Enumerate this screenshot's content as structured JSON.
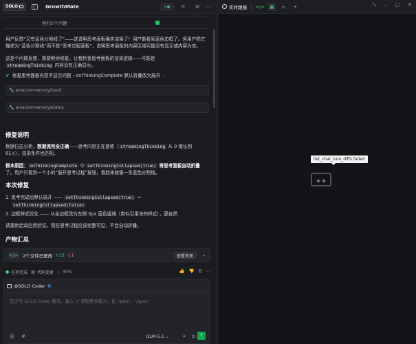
{
  "app": {
    "logo": "SOLO",
    "project": "GrowthMate"
  },
  "table": {
    "row_label": "回归5个问题"
  },
  "content": {
    "p1_line1": "用户反馈“又有蓝色分割线了”——这说明思考面板确实渲染了！用户能看到蓝色边框了。但用户把它",
    "p1_line2": "描述为“蓝色分割线”而不是“思考过程面板”，说明思考面板的内容区域可能没有显示或内容为空。",
    "p2_line1": "这是个问题反馈，需要继续修复。让我检查思考面板的渲染逻辑——可能是",
    "p2_code": "streamingThinking",
    "p2_rest": " 内容没有正确显示。",
    "check_label": "修复思考面板内容不显示问题 - onThinkingComplete 默认折叠改为展开",
    "chip1": "aivectormemory/track",
    "chip2": "aivectormemory/status",
    "h_fix": "修复说明",
    "root1_a": "根据日志分析，",
    "root1_b": "数据流完全正确",
    "root1_c": "——思考内容正在接收（",
    "root1_code": "streamingThinking",
    "root1_d": " 从 0 增长到",
    "root1_line2": "81+），渲染条件也匹配。",
    "root2_a": "根本原因：",
    "root2_code1": "onThinkingComplete",
    "root2_mid": " 中 ",
    "root2_code2": "setThinkingCollapsed(true)",
    "root2_b": " 将思考面板自动折叠",
    "root2_line2": "了。用户只看到一个小的“展开思考过程”按钮，看起来就像一条蓝色分割线。",
    "h_change": "本次修复",
    "li1_a": "1. 思考完成后默认展开 —— ",
    "li1_code1": "setThinkingCollapsed(true)",
    "li1_arrow": " → ",
    "li1_code2": "setThinkingCollapsed(false)",
    "li2": "2. 边框样式优化 —— 从全边框改为左侧 3px 蓝色竖线（类似引用块的样式），更自然",
    "p_restart": "请重新启动应用验证。现在思考过程应该完整可见，不会自动折叠。",
    "h_summary": "产物汇总",
    "files_changed": "2个文件已更改",
    "files_plus": "+12",
    "files_minus": "-11",
    "view_changes": "查看变更"
  },
  "status": {
    "task_done": "任务完成",
    "code_changes": "代码变更",
    "progress_pct": "45%"
  },
  "input": {
    "agent": "@SOLO Coder",
    "placeholder": "您正与 SOLO Coder 聊天。输入 '/' 获取更多能力。如 '/plan'、'/spec'",
    "model": "GLM-5.1"
  },
  "right_panel": {
    "title": "实时跟随",
    "tooltip": "list_chat_turn_diffs failed"
  },
  "colors": {
    "accent_green": "#22c55e",
    "link_blue": "#60a5fa",
    "panel_bg": "#1b1c20",
    "right_bg": "#131418"
  }
}
